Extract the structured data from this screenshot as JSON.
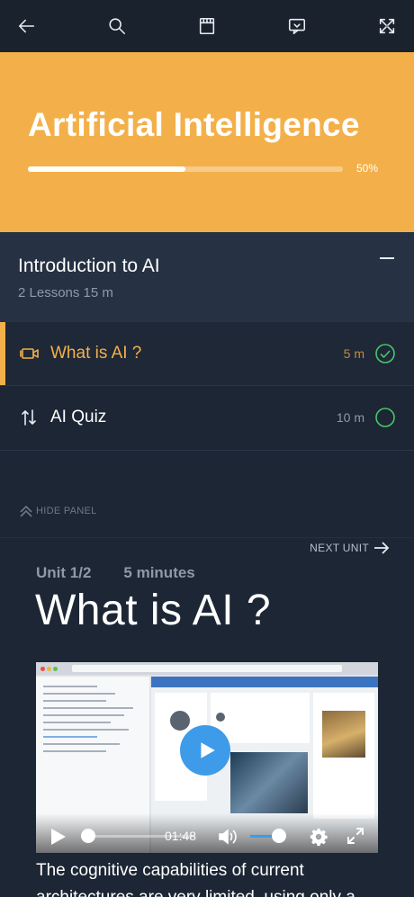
{
  "toolbar": {
    "buttons": [
      "back-arrow-icon",
      "search-icon",
      "notes-icon",
      "chat-icon",
      "expand-icon"
    ]
  },
  "course": {
    "title": "Artificial Intelligence",
    "progress": 0.5,
    "progress_label": "50%"
  },
  "section": {
    "title": "Introduction to AI",
    "meta": "2 Lessons  15 m"
  },
  "lessons": [
    {
      "title": "What is AI ?",
      "duration": "5 m",
      "icon": "video-icon",
      "active": true,
      "completed": true
    },
    {
      "title": "AI Quiz",
      "duration": "10 m",
      "icon": "quiz-arrows-icon",
      "active": false,
      "completed": false
    }
  ],
  "panel": {
    "hide_label": "HIDE PANEL"
  },
  "unit": {
    "next_label": "NEXT UNIT",
    "number": "Unit 1/2",
    "duration": "5 minutes",
    "title": "What is AI ?"
  },
  "video": {
    "time": "01:48",
    "progress": 0.1,
    "volume": 0.8
  },
  "content": {
    "text": "The cognitive capabilities of current architectures are very limited, using only a"
  },
  "colors": {
    "accent": "#f3b04a",
    "success": "#4cc46d",
    "background": "#1c2634",
    "section": "#263243",
    "video_accent": "#3d9be9"
  }
}
